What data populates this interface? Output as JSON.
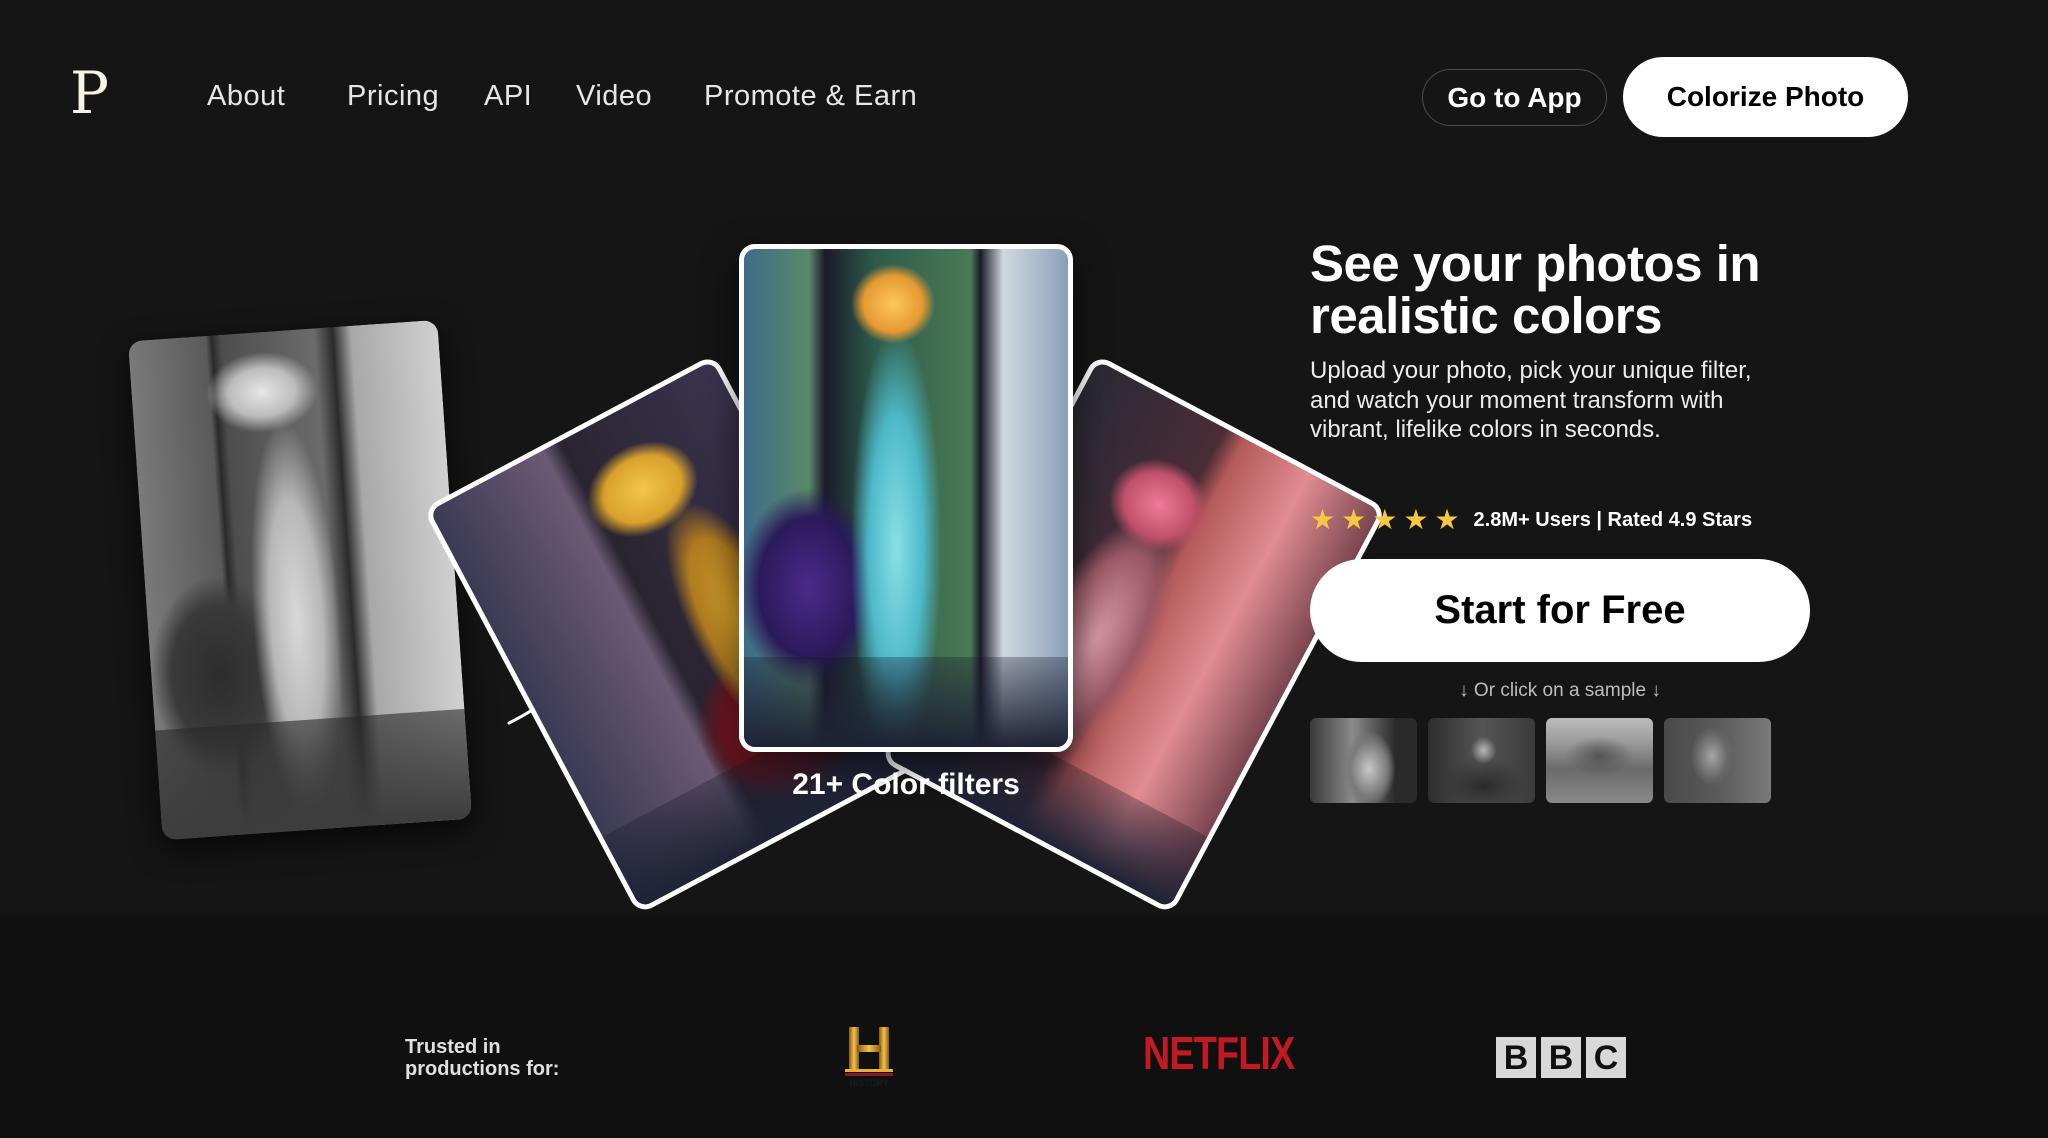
{
  "header": {
    "logo": "P",
    "nav": [
      {
        "label": "About"
      },
      {
        "label": "Pricing"
      },
      {
        "label": "API"
      },
      {
        "label": "Video"
      },
      {
        "label": "Promote & Earn"
      }
    ],
    "go_to_app_label": "Go to App",
    "colorize_label": "Colorize Photo"
  },
  "hero": {
    "headline": "See your photos in realistic colors",
    "subtext": "Upload your photo, pick your unique filter, and watch your moment transform with vibrant, lifelike colors in seconds.",
    "rating": {
      "stars": 5,
      "star_icon": "★",
      "text": "2.8M+ Users | Rated 4.9 Stars",
      "star_color": "#f5c842"
    },
    "cta_label": "Start for Free",
    "sample_hint": "↓ Or click on a sample ↓",
    "samples": [
      {
        "name": "sample-woman-garden"
      },
      {
        "name": "sample-man-desk"
      },
      {
        "name": "sample-garden-path"
      },
      {
        "name": "sample-mother-children"
      }
    ],
    "filters_caption": "21+ Color filters"
  },
  "trusted": {
    "label": "Trusted in productions for:",
    "logos": {
      "history": {
        "letter": "H",
        "text": "HISTORY",
        "color": "#d4a02a"
      },
      "netflix": {
        "text": "NETFLIX",
        "color": "#c11a22"
      },
      "bbc": {
        "letters": [
          "B",
          "B",
          "C"
        ]
      }
    }
  }
}
